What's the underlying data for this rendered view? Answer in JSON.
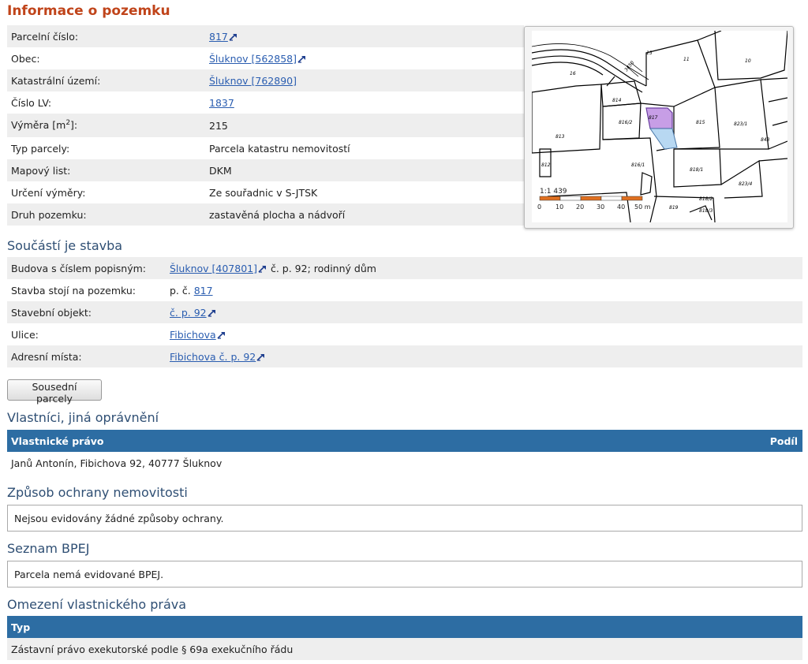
{
  "header": {
    "title": "Informace o pozemku"
  },
  "parcel": {
    "parcelni_cislo": {
      "label": "Parcelní číslo:",
      "value": "817"
    },
    "obec": {
      "label": "Obec:",
      "value": "Šluknov [562858]"
    },
    "katastralni_uzemi": {
      "label": "Katastrální území:",
      "value": "Šluknov [762890]"
    },
    "cislo_lv": {
      "label": "Číslo LV:",
      "value": "1837"
    },
    "vymera": {
      "label": "Výměra [m",
      "label_sup": "2",
      "label_end": "]:",
      "value": "215"
    },
    "typ_parcely": {
      "label": "Typ parcely:",
      "value": "Parcela katastru nemovitostí"
    },
    "mapovy_list": {
      "label": "Mapový list:",
      "value": "DKM"
    },
    "urceni_vymery": {
      "label": "Určení výměry:",
      "value": "Ze souřadnic v S-JTSK"
    },
    "druh_pozemku": {
      "label": "Druh pozemku:",
      "value": "zastavěná plocha a nádvoří"
    }
  },
  "map": {
    "scale_label": "1:1 439",
    "scale_ticks": [
      "0",
      "10",
      "20",
      "30",
      "40",
      "50 m"
    ],
    "parcel_labels": [
      "817",
      "815",
      "814",
      "816/2",
      "813",
      "812",
      "816/1",
      "818/1",
      "818/2",
      "818/3",
      "823/1",
      "823/4",
      "11",
      "10",
      "15",
      "16",
      "843",
      "819",
      "3450"
    ],
    "colors": {
      "selected_parcel": "#c79ee6",
      "building": "#b8d8f2",
      "scale_bar": "#e07020"
    }
  },
  "stavba": {
    "heading": "Součástí je stavba",
    "budova": {
      "label": "Budova s číslem popisným:",
      "link": "Šluknov [407801]",
      "rest": " č. p. 92; rodinný dům"
    },
    "stoji_na": {
      "label": "Stavba stojí na pozemku:",
      "prefix": "p. č. ",
      "link": "817"
    },
    "stavebni_objekt": {
      "label": "Stavební objekt:",
      "link": "č. p. 92"
    },
    "ulice": {
      "label": "Ulice:",
      "link": "Fibichova"
    },
    "adresni_mista": {
      "label": "Adresní místa:",
      "link": "Fibichova č. p. 92"
    }
  },
  "neighbors_button": "Sousední parcely",
  "vlastnici": {
    "heading": "Vlastníci, jiná oprávnění",
    "col_right": "Vlastnické právo",
    "col_share": "Podíl",
    "owner": "Janů Antonín, Fibichova 92, 40777 Šluknov"
  },
  "ochrana": {
    "heading": "Způsob ochrany nemovitosti",
    "text": "Nejsou evidovány žádné způsoby ochrany."
  },
  "bpej": {
    "heading": "Seznam BPEJ",
    "text": "Parcela nemá evidované BPEJ."
  },
  "omezeni": {
    "heading": "Omezení vlastnického práva",
    "col_type": "Typ",
    "row": "Zástavní právo exekutorské podle § 69a exekučního řádu"
  }
}
